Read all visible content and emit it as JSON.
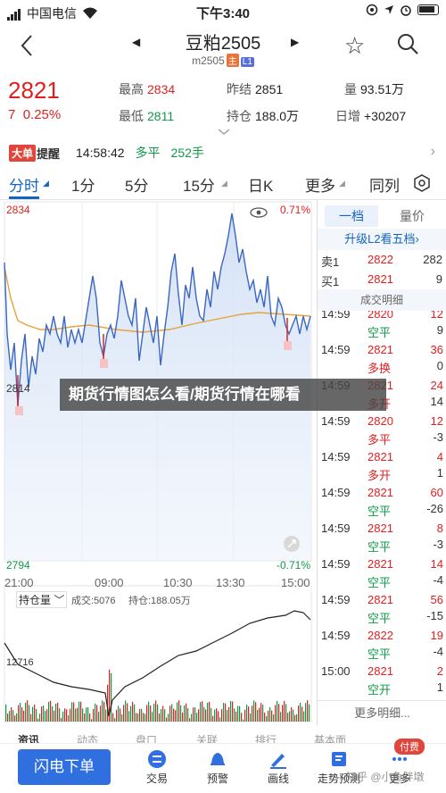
{
  "status": {
    "carrier": "中国电信",
    "time": "下午3:40"
  },
  "nav": {
    "title": "豆粕2505",
    "subtitle": "m2505",
    "badge_main": "主",
    "badge_l1": "L1"
  },
  "quote": {
    "price": "2821",
    "change": "7",
    "change_pct": "0.25%",
    "high_label": "最高",
    "high": "2834",
    "low_label": "最低",
    "low": "2811",
    "prev_label": "昨结",
    "prev": "2851",
    "oi_label": "持仓",
    "oi": "188.0万",
    "vol_label": "量",
    "vol": "93.51万",
    "daily_label": "日增",
    "daily": "+30207"
  },
  "alert": {
    "tag": "大单",
    "tag2": "提醒",
    "time": "14:58:42",
    "type": "多平",
    "qty": "252手"
  },
  "tabs": [
    "分时",
    "1分",
    "5分",
    "15分",
    "日K",
    "更多",
    "同列"
  ],
  "chart_top": {
    "price_high": "2834",
    "pct_high": "0.71%",
    "mid_price": "2814",
    "price_low": "2794",
    "pct_low": "-0.71%",
    "times": [
      "21:00",
      "09:00",
      "10:30",
      "13:30",
      "15:00"
    ],
    "oi_selector": "持仓量",
    "vol_label": "成交:5076",
    "oi_label": "持仓:188.05万",
    "oi_axis": "12716"
  },
  "side": {
    "tab1": "一档",
    "tab2": "量价",
    "upgrade": "升级L2看五档›",
    "asks": [
      {
        "label": "卖1",
        "price": "2822",
        "vol": "282"
      }
    ],
    "bids": [
      {
        "label": "买1",
        "price": "2821",
        "vol": "9"
      }
    ],
    "detail_header": "成交明细",
    "trades": [
      {
        "time": "14:59",
        "price": "2820",
        "qty": "12",
        "type": "空平",
        "chg": "9"
      },
      {
        "time": "14:59",
        "price": "2821",
        "qty": "36",
        "type": "多换",
        "chg": "0"
      },
      {
        "time": "14:59",
        "price": "2821",
        "qty": "24",
        "type": "多开",
        "chg": "14"
      },
      {
        "time": "14:59",
        "price": "2820",
        "qty": "12",
        "type": "多平",
        "chg": "-3"
      },
      {
        "time": "14:59",
        "price": "2821",
        "qty": "4",
        "type": "多开",
        "chg": "1"
      },
      {
        "time": "14:59",
        "price": "2821",
        "qty": "60",
        "type": "空平",
        "chg": "-26"
      },
      {
        "time": "14:59",
        "price": "2821",
        "qty": "8",
        "type": "空平",
        "chg": "-3"
      },
      {
        "time": "14:59",
        "price": "2821",
        "qty": "14",
        "type": "空平",
        "chg": "-4"
      },
      {
        "time": "14:59",
        "price": "2821",
        "qty": "56",
        "type": "空平",
        "chg": "-15"
      },
      {
        "time": "14:59",
        "price": "2822",
        "qty": "19",
        "type": "空平",
        "chg": "-4"
      },
      {
        "time": "15:00",
        "price": "2821",
        "qty": "2",
        "type": "空开",
        "chg": "1"
      }
    ],
    "more": "更多明细..."
  },
  "watermark": "期货行情图怎么看/期货行情在哪看",
  "bottom_tabs": [
    "资讯",
    "动态",
    "盘口",
    "关联",
    "排行",
    "基本面"
  ],
  "bottom_bar": {
    "flash": "闪电下单",
    "items": [
      "交易",
      "预警",
      "画线",
      "走势预测",
      "更多"
    ],
    "pay": "付费",
    "credit": "知乎 @小鱼胖墩"
  },
  "colors": {
    "up": "#e02020",
    "down": "#109a48",
    "accent": "#1565c0"
  }
}
